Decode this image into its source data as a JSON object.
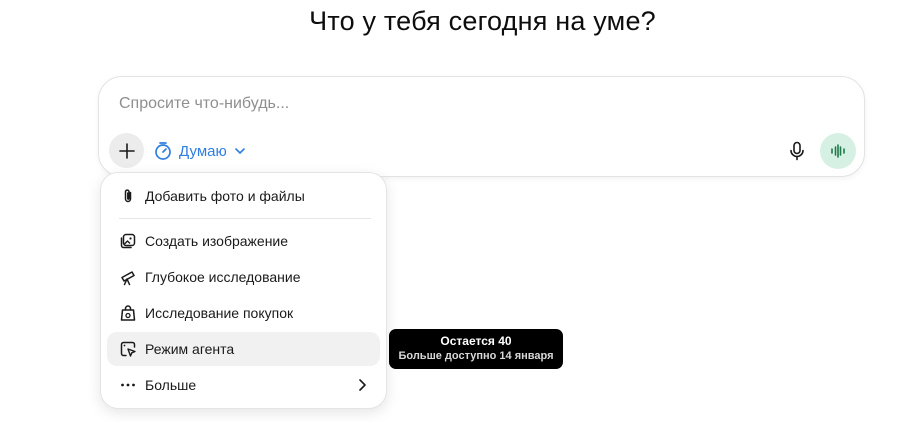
{
  "main": {
    "heading": "Что у тебя сегодня на уме?"
  },
  "composer": {
    "placeholder": "Спросите что-нибудь...",
    "add_button_icon": "plus-icon",
    "mode_label": "Думаю",
    "mode_icon": "timer-icon",
    "mode_color": "#2f7ee0",
    "mic_icon": "microphone-icon",
    "voice_icon": "voice-waveform-icon",
    "voice_button_color": "#d6f1e4"
  },
  "menu": {
    "items": [
      {
        "label": "Добавить фото и файлы",
        "icon": "paperclip-icon"
      },
      {
        "label": "Создать изображение",
        "icon": "image-icon"
      },
      {
        "label": "Глубокое исследование",
        "icon": "telescope-icon"
      },
      {
        "label": "Исследование покупок",
        "icon": "shopping-bag-icon"
      },
      {
        "label": "Режим агента",
        "icon": "agent-cursor-icon",
        "highlighted": true
      },
      {
        "label": "Больше",
        "icon": "more-dots-icon",
        "has_submenu": true
      }
    ]
  },
  "tooltip": {
    "line1": "Остается 40",
    "line2": "Больше доступно 14 января"
  }
}
